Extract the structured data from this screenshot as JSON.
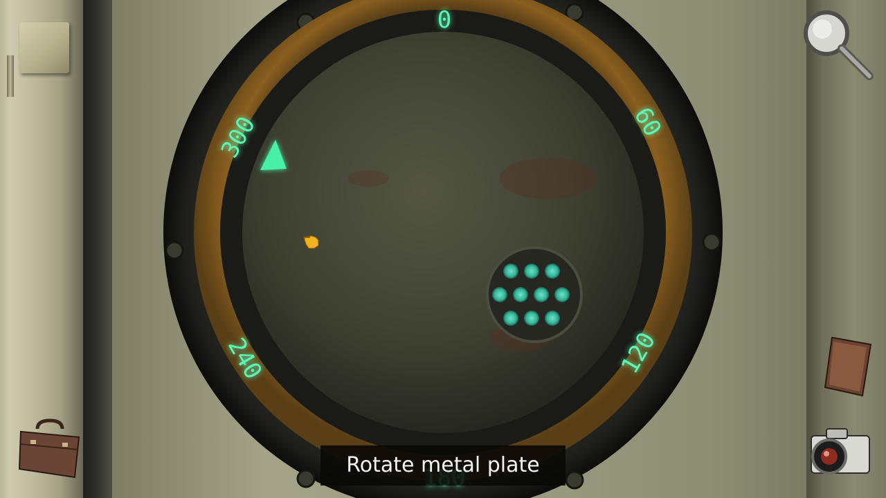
{
  "dial": {
    "markings": [
      "0",
      "60",
      "120",
      "180",
      "240",
      "300"
    ],
    "pointer_color": "#46f0a6",
    "glow_color": "#3ff2a2",
    "hole_grid": {
      "rows": 3,
      "cols": [
        3,
        4,
        3
      ]
    }
  },
  "caption": {
    "text": "Rotate metal plate"
  },
  "inventory": {
    "top_tool": "magnifying-glass-icon",
    "items": [
      "notebook-icon",
      "camera-icon"
    ],
    "bag": "briefcase-icon"
  },
  "colors": {
    "ring_bronze": "#8a5f1f",
    "plate": "#3f4232",
    "wall": "#9a9a7f",
    "text": "#f4f4ee"
  }
}
